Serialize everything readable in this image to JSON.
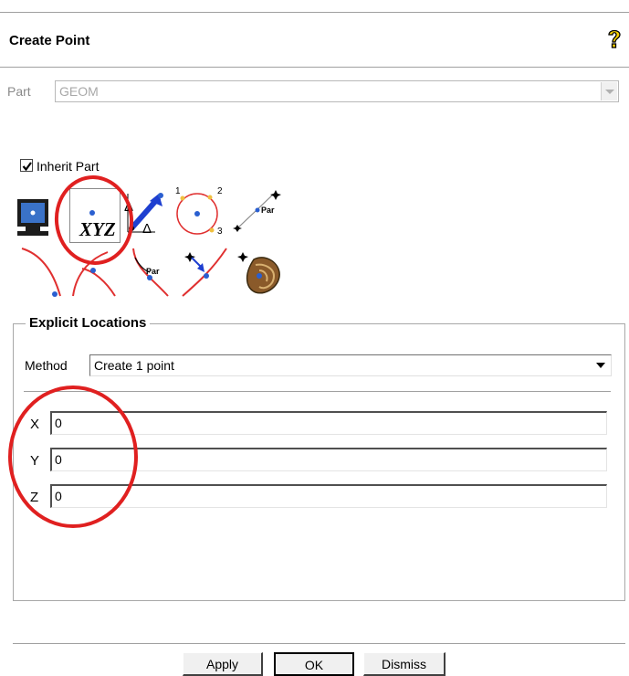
{
  "window": {
    "title": "Create Point"
  },
  "part": {
    "label": "Part",
    "value": "GEOM"
  },
  "inherit_part": {
    "label": "Inherit Part",
    "checked": true
  },
  "tools": {
    "row1": [
      "screen-select-icon",
      "xyz-icon",
      "offset-delta-icon",
      "three-point-circle-icon",
      "parameter-along-line-icon"
    ],
    "row2": [
      "curve-end-points-icon",
      "curve-intersection-icon",
      "parameter-along-curve-icon",
      "project-to-curve-icon",
      "project-to-surface-icon"
    ],
    "xyz_label": "XYZ",
    "delta_label": "Δ",
    "par_label": "Par",
    "circle_numbers": [
      "1",
      "2",
      "3"
    ]
  },
  "explicit": {
    "title": "Explicit Locations",
    "method_label": "Method",
    "method_value": "Create 1 point",
    "fields": [
      {
        "label": "X",
        "value": "0"
      },
      {
        "label": "Y",
        "value": "0"
      },
      {
        "label": "Z",
        "value": "0"
      }
    ]
  },
  "buttons": {
    "apply": "Apply",
    "ok": "OK",
    "dismiss": "Dismiss"
  },
  "annotation_color": "#e02020"
}
